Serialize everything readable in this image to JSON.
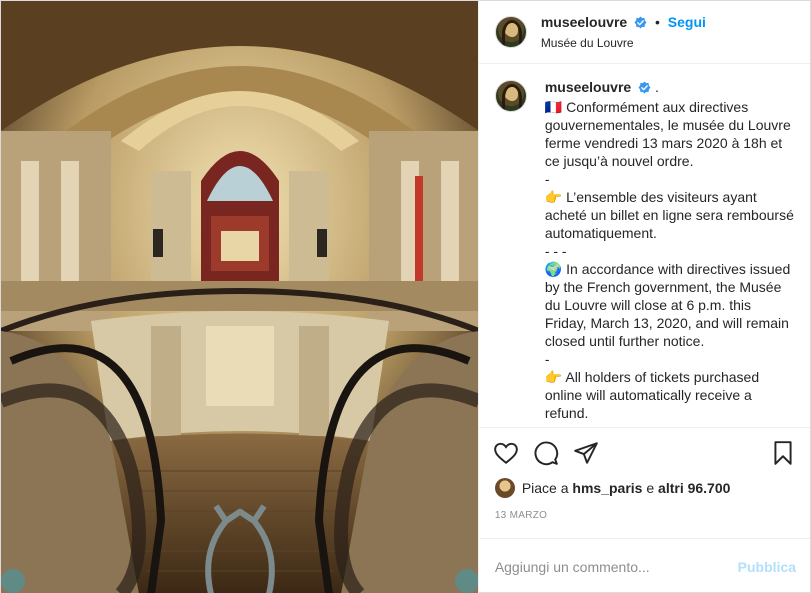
{
  "header": {
    "username": "museelouvre",
    "follow_label": "Segui",
    "location": "Musée du Louvre"
  },
  "caption": {
    "username": "museelouvre",
    "after_name": ".",
    "lines": [
      "🇫🇷 Conformément aux directives gouvernementales, le musée du Louvre ferme vendredi 13 mars 2020 à 18h et ce jusqu’à nouvel ordre.",
      "-",
      "👉 L’ensemble des visiteurs ayant acheté un billet en ligne sera remboursé automatiquement.",
      "- - -",
      "🌍 In accordance with directives issued by the French government, the Musée du Louvre will close at 6 p.m. this Friday, March 13, 2020, and will remain closed until further notice.",
      "-",
      "👉 All holders of tickets purchased online will automatically receive a refund.",
      "-"
    ]
  },
  "actions": {
    "like_icon": "heart-icon",
    "comment_icon": "comment-icon",
    "share_icon": "paper-plane-icon",
    "save_icon": "bookmark-icon"
  },
  "likes": {
    "prefix": "Piace a",
    "user": "hms_paris",
    "middle": "e",
    "count": "altri 96.700"
  },
  "date": "13 MARZO",
  "comment": {
    "placeholder": "Aggiungi un commento...",
    "publish_label": "Pubblica"
  },
  "colors": {
    "accent": "#0095f6",
    "verified": "#3897f0",
    "muted": "#8e8e8e",
    "publish_disabled": "#b2dffc"
  }
}
